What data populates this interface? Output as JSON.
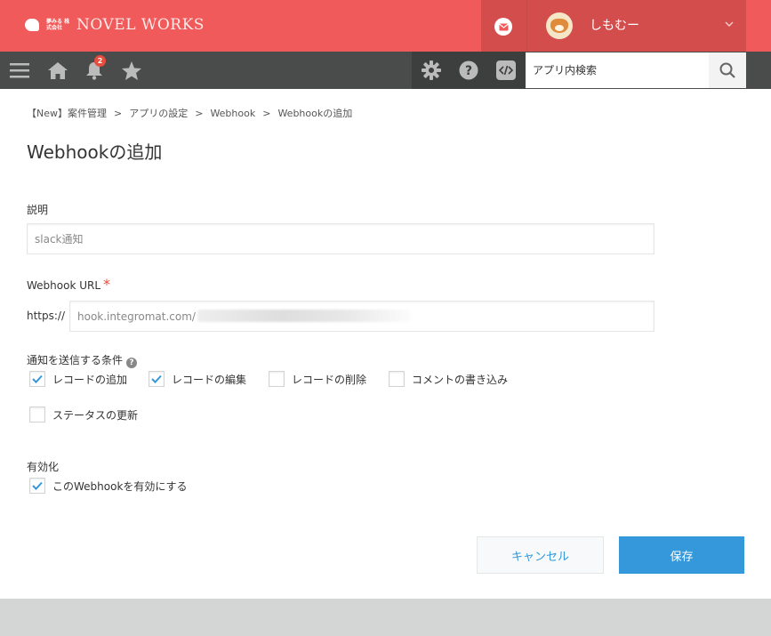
{
  "header": {
    "logo_small": "夢みる 株式会社",
    "logo_text": "NOVEL WORKS",
    "user_name": "しもむー"
  },
  "nav": {
    "notification_count": "2",
    "search_placeholder": "アプリ内検索"
  },
  "breadcrumb": [
    "【New】案件管理",
    "アプリの設定",
    "Webhook",
    "Webhookの追加"
  ],
  "breadcrumb_sep": ">",
  "page_title": "Webhookの追加",
  "form": {
    "description_label": "説明",
    "description_value": "slack通知",
    "url_label": "Webhook URL",
    "url_required_mark": "*",
    "url_prefix": "https://",
    "url_value": "hook.integromat.com/",
    "conditions_label": "通知を送信する条件",
    "conditions": [
      {
        "label": "レコードの追加",
        "checked": true
      },
      {
        "label": "レコードの編集",
        "checked": true
      },
      {
        "label": "レコードの削除",
        "checked": false
      },
      {
        "label": "コメントの書き込み",
        "checked": false
      },
      {
        "label": "ステータスの更新",
        "checked": false
      }
    ],
    "enable_label": "有効化",
    "enable_option": {
      "label": "このWebhookを有効にする",
      "checked": true
    }
  },
  "buttons": {
    "cancel": "キャンセル",
    "save": "保存"
  },
  "colors": {
    "header_red": "#f05a5a",
    "header_dark_red": "#d34d4d",
    "nav_dark": "#4a4b4b",
    "accent_blue": "#3498db",
    "required_red": "#e74c3c"
  }
}
